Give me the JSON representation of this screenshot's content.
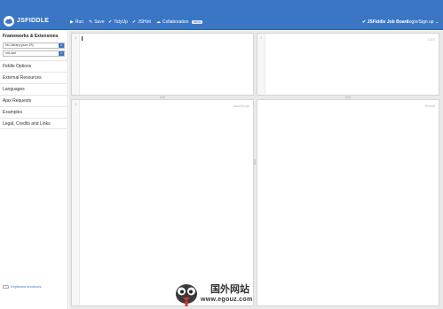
{
  "topbar": {
    "brand": "JSFIDDLE",
    "brand_caret": "⌄",
    "buttons": [
      {
        "icon": "play-icon",
        "glyph": "▶",
        "label": "Run"
      },
      {
        "icon": "pencil-icon",
        "glyph": "✎",
        "label": "Save"
      },
      {
        "icon": "check-icon",
        "glyph": "✔",
        "label": "TidyUp"
      },
      {
        "icon": "check-icon",
        "glyph": "✔",
        "label": "JSHint"
      },
      {
        "icon": "cloud-icon",
        "glyph": "☁",
        "label": "Collaboration",
        "badge": "BETA"
      }
    ],
    "job_board": "JSFiddle Job Board",
    "job_board_icon": "✔",
    "signin": "Login/Sign up",
    "signin_caret": "⌄"
  },
  "sidebar": {
    "heading": "Frameworks & Extensions",
    "framework_select": "No-Library (pure JS)",
    "load_select": "onLoad",
    "items": [
      {
        "label": "Fiddle Options"
      },
      {
        "label": "External Resources"
      },
      {
        "label": "Languages"
      },
      {
        "label": "Ajax Requests"
      },
      {
        "label": "Examples"
      },
      {
        "label": "Legal, Credits and Links"
      }
    ],
    "footer": "Keyboard shortcuts"
  },
  "panels": {
    "html": {
      "line": "1",
      "label": ""
    },
    "css": {
      "line": "1",
      "label": "CSS"
    },
    "js": {
      "line": "1",
      "label": "JavaScript"
    },
    "result": {
      "label": "Result"
    }
  },
  "watermark": {
    "cn": "国外网站",
    "url": "www.egouz.com"
  },
  "colors": {
    "topbar": "#3a76c4",
    "accent": "#3a76c4",
    "panel_bg": "#e9e9e9"
  }
}
